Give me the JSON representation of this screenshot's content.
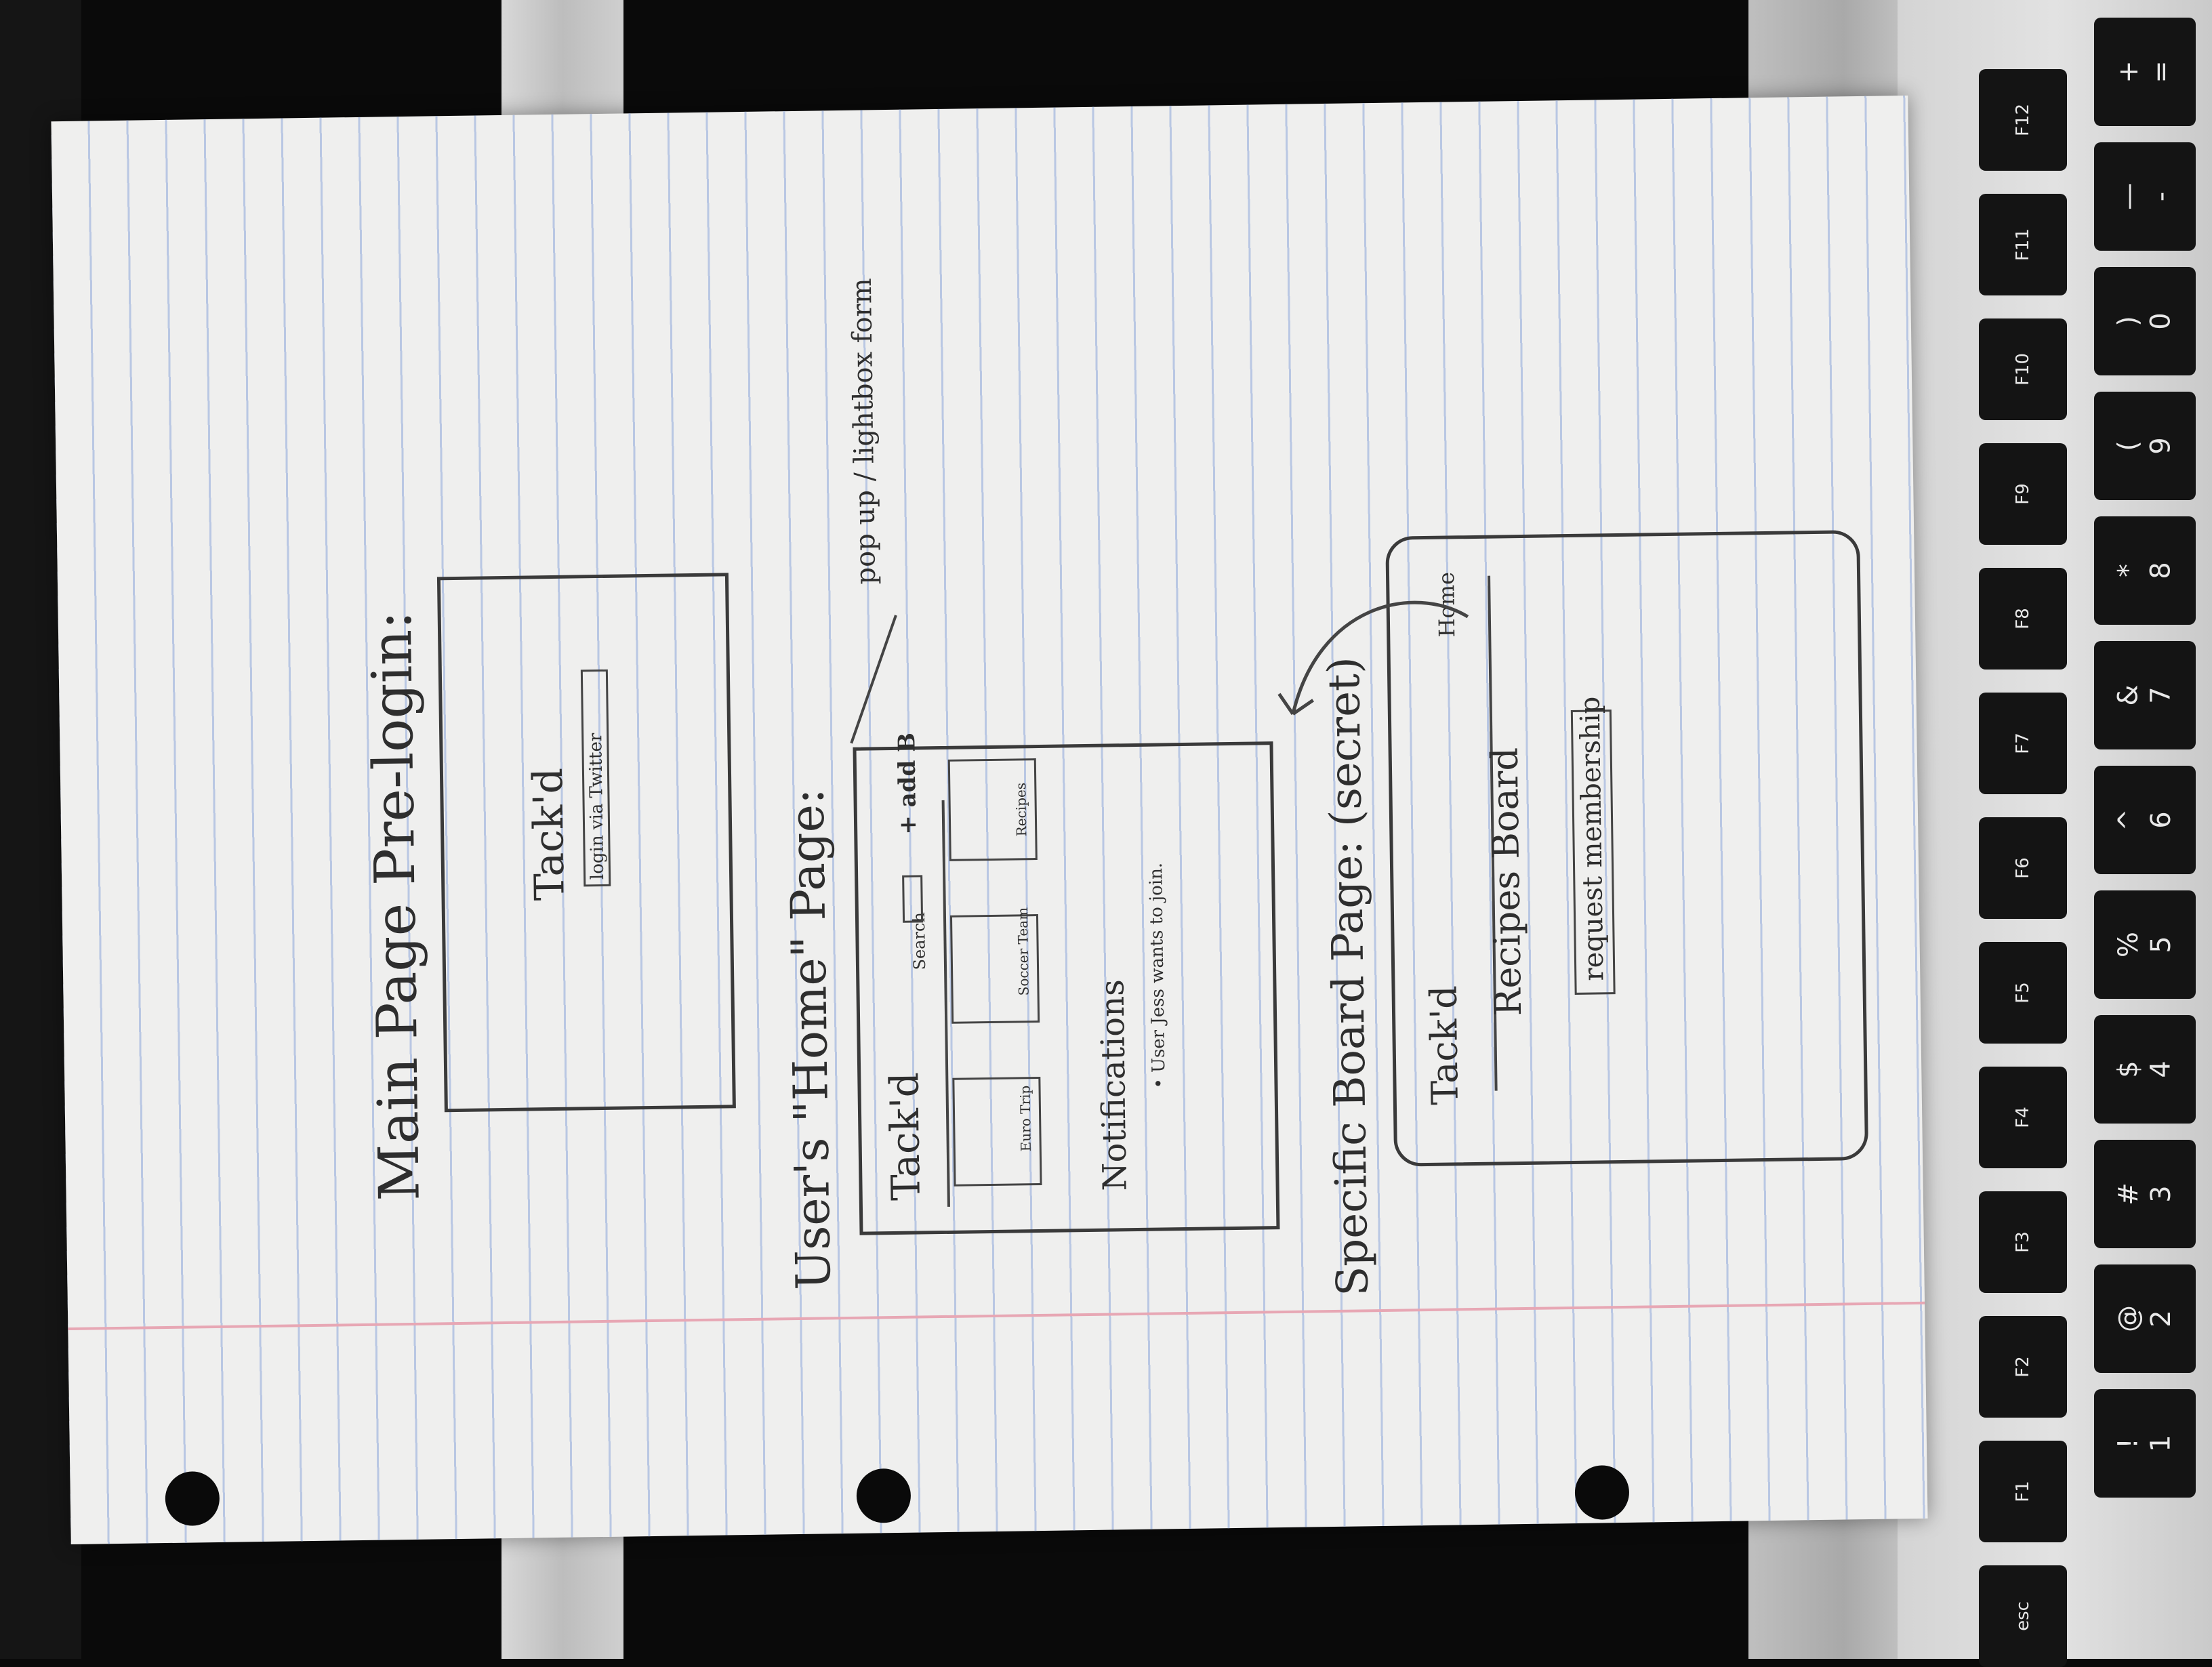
{
  "sketch": {
    "section1": {
      "heading": "Main Page Pre-login:",
      "logo": "Tack'd",
      "login_button": "login via Twitter"
    },
    "section2": {
      "heading": "User's \"Home\" Page:",
      "logo": "Tack'd",
      "search_label": "Search",
      "add_button": "+ add B",
      "boards": [
        "Euro Trip",
        "Soccer Team",
        "Recipes"
      ],
      "notifications_title": "Notifications",
      "notification_item": "• User Jess wants to join.",
      "annotation": "pop up / lightbox form"
    },
    "section3": {
      "heading": "Specific Board Page: (secret)",
      "logo": "Tack'd",
      "home_link": "Home",
      "board_title": "Recipes Board",
      "request_button": "request membership"
    }
  },
  "keyboard": {
    "function_keys": [
      "esc",
      "F1",
      "F2",
      "F3",
      "F4",
      "F5",
      "F6",
      "F7",
      "F8",
      "F9",
      "F10",
      "F11",
      "F12"
    ],
    "number_keys": [
      "!\n1",
      "@\n2",
      "#\n3",
      "$\n4",
      "%\n5",
      "^\n6",
      "&\n7",
      "*\n8",
      "(\n9",
      ")\n0",
      "—\n-",
      "+\n="
    ]
  }
}
